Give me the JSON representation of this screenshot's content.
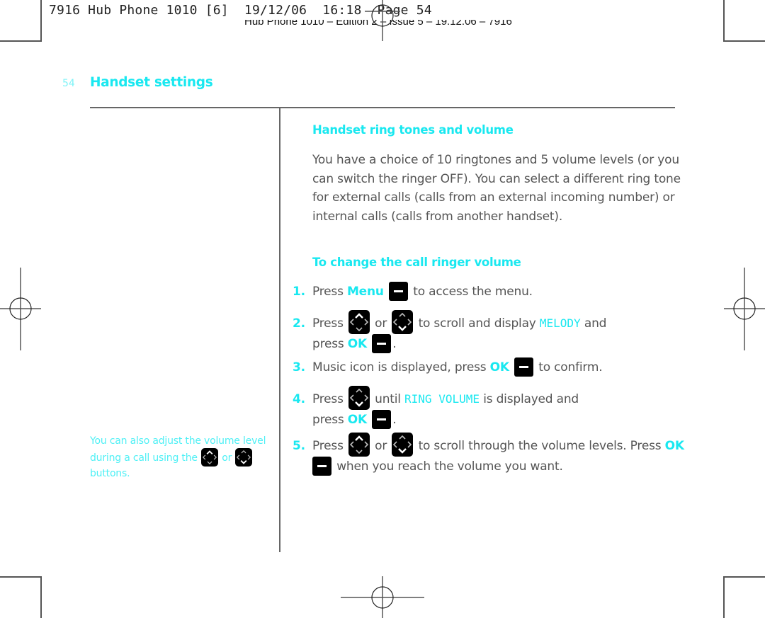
{
  "slug": {
    "line1": "7916 Hub Phone 1010 [6]  19/12/06  16:18  Page 54",
    "line2": "Hub Phone 1010 – Edition 2 – Issue 5 – 19.12.06 – 7916"
  },
  "page": {
    "number": "54",
    "section_title": "Handset settings"
  },
  "main": {
    "heading1": "Handset ring tones and volume",
    "intro": "You have a choice of 10 ringtones and 5 volume levels (or you can switch the ringer OFF). You can select a different ring tone for external calls (calls from an external incoming number) or internal calls (calls from another handset).",
    "heading2": "To change the call ringer volume",
    "steps": [
      {
        "num": "1.",
        "a": "Press ",
        "key_label": "Menu",
        "b": " to access the menu."
      },
      {
        "num": "2.",
        "a": "Press ",
        "or": " or ",
        "b": " to scroll and display ",
        "lcd": "MELODY",
        "c": " and",
        "d": "press ",
        "key_label": "OK",
        "e": "."
      },
      {
        "num": "3.",
        "a": "Music icon is displayed, press ",
        "key_label": "OK",
        "b": " to confirm."
      },
      {
        "num": "4.",
        "a": "Press ",
        "b": " until ",
        "lcd": "RING VOLUME",
        "c": " is displayed and",
        "d": "press ",
        "key_label": "OK",
        "e": "."
      },
      {
        "num": "5.",
        "a": "Press ",
        "or": " or ",
        "b": " to scroll through the volume levels. Press ",
        "key_label": "OK",
        "c": " when you reach the volume you want."
      }
    ]
  },
  "side_note": {
    "a": "You can also adjust the volume level during a call using the ",
    "or": " or ",
    "b": "buttons."
  },
  "icons": {
    "soft_key": "softkey-minus-icon",
    "nav_up": "nav-up-icon",
    "nav_down": "nav-down-icon",
    "crop_mark": "crop-mark",
    "registration_mark": "registration-mark"
  },
  "colors": {
    "accent_cyan": "#19e8f0",
    "body_grey": "#555555",
    "key_black": "#000000"
  }
}
